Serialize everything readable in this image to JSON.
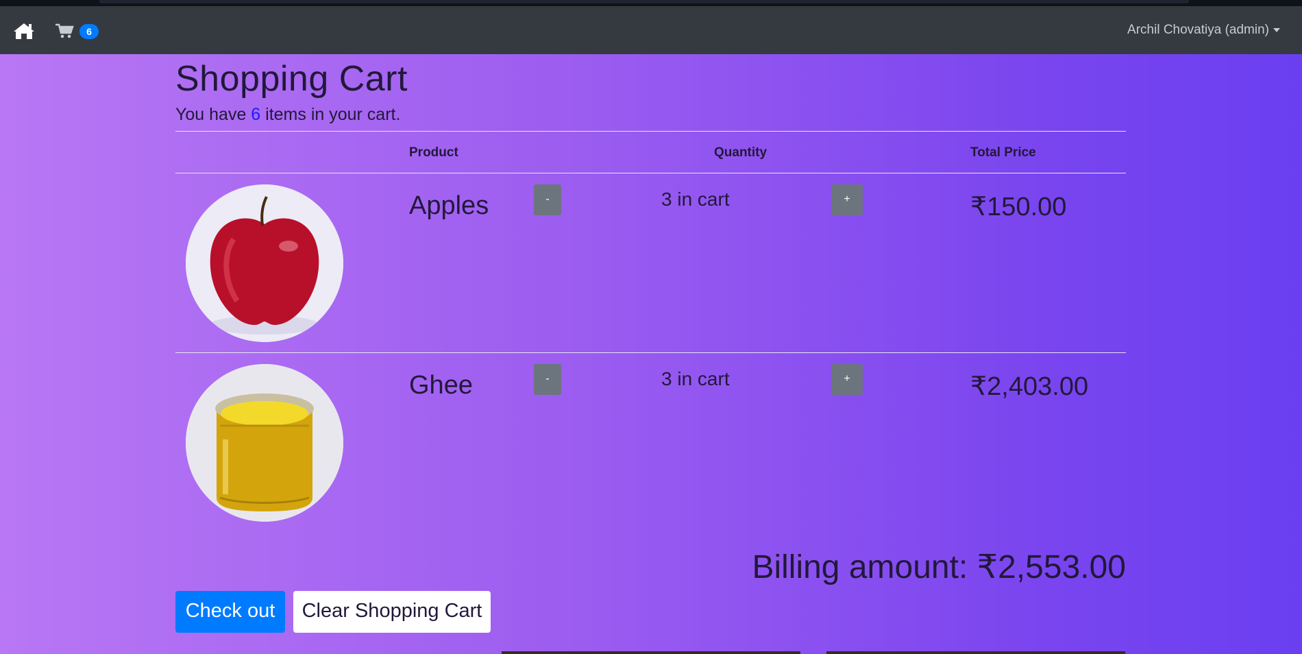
{
  "navbar": {
    "home_icon": "home-icon",
    "cart_icon": "shopping-cart-icon",
    "cart_count": "6",
    "user_label": "Archil Chovatiya (admin)"
  },
  "page": {
    "title": "Shopping Cart",
    "subtitle_prefix": "You have ",
    "subtitle_count": "6",
    "subtitle_suffix": " items in your cart."
  },
  "table": {
    "headers": {
      "product": "Product",
      "quantity": "Quantity",
      "total_price": "Total Price"
    },
    "rows": [
      {
        "name": "Apples",
        "quantity_text": "3 in cart",
        "total": "₹150.00",
        "decrement": "-",
        "increment": "+",
        "image": "apple"
      },
      {
        "name": "Ghee",
        "quantity_text": "3 in cart",
        "total": "₹2,403.00",
        "decrement": "-",
        "increment": "+",
        "image": "ghee-jar"
      }
    ]
  },
  "billing": {
    "label": "Billing amount: ₹2,553.00"
  },
  "actions": {
    "checkout": "Check out",
    "clear": "Clear Shopping Cart"
  },
  "colors": {
    "navbar": "#343a40",
    "primary": "#007bff",
    "secondary": "#6c757d",
    "gradient_start": "#b877f4",
    "gradient_end": "#6a3ff0"
  }
}
